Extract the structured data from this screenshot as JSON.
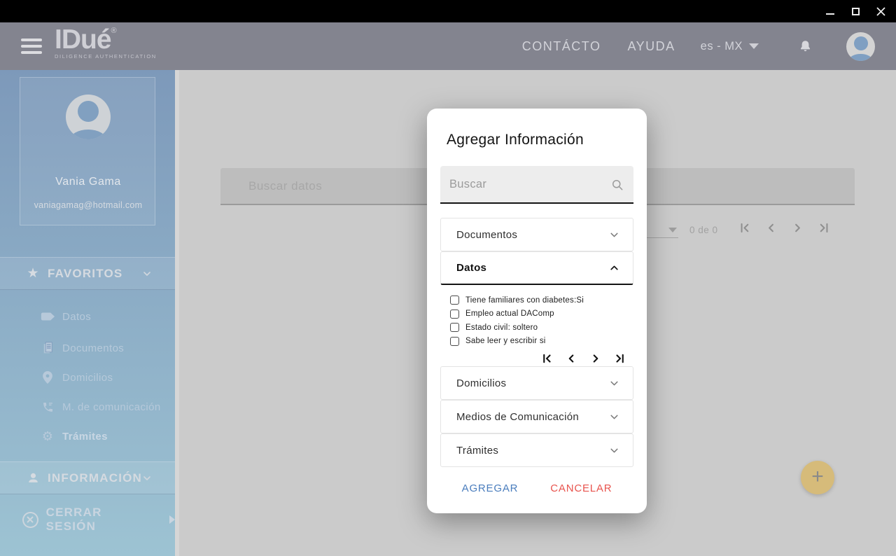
{
  "window": {
    "controls": {
      "minimize": "minimize",
      "maximize": "maximize",
      "close": "close"
    }
  },
  "header": {
    "logo": "IDué",
    "logo_mark": "®",
    "logo_sub": "DILIGENCE AUTHENTICATION",
    "nav": [
      {
        "label": "CONTÁCTO"
      },
      {
        "label": "AYUDA"
      }
    ],
    "language": "es - MX"
  },
  "sidebar": {
    "user": {
      "name": "Vania Gama",
      "email": "vaniagamag@hotmail.com"
    },
    "favorites": {
      "label": "FAVORITOS",
      "items": [
        {
          "label": "Datos",
          "icon": "tag-icon"
        },
        {
          "label": "Documentos",
          "icon": "documents-icon"
        },
        {
          "label": "Domicilios",
          "icon": "location-pin-icon"
        },
        {
          "label": "M. de comunicación",
          "icon": "phone-icon"
        },
        {
          "label": "Trámites",
          "icon": "gear-icon"
        }
      ]
    },
    "information": {
      "label": "INFORMACIÓN"
    },
    "logout": {
      "label": "CERRAR SESIÓN"
    }
  },
  "content": {
    "search_placeholder": "Buscar datos",
    "pagination": {
      "range_label": "0 de 0"
    }
  },
  "fab": {
    "icon": "plus",
    "color": "#d6bb7a"
  },
  "modal": {
    "title": "Agregar Información",
    "search_placeholder": "Buscar",
    "sections": [
      {
        "label": "Documentos",
        "expanded": false
      },
      {
        "label": "Datos",
        "expanded": true,
        "items": [
          {
            "label": "Tiene familiares con diabetes:Si",
            "checked": false
          },
          {
            "label": "Empleo actual DAComp",
            "checked": false
          },
          {
            "label": "Estado civil: soltero",
            "checked": false
          },
          {
            "label": "Sabe leer y escribir si",
            "checked": false
          }
        ]
      },
      {
        "label": "Domicilios",
        "expanded": false
      },
      {
        "label": "Medios de Comunicación",
        "expanded": false
      },
      {
        "label": "Trámites",
        "expanded": false
      }
    ],
    "actions": {
      "add": "AGREGAR",
      "cancel": "CANCELAR"
    }
  },
  "colors": {
    "accent_blue": "#4a7dbd",
    "accent_red": "#e8544e",
    "fab_yellow": "#d6bb7a",
    "header_gray": "#83848f",
    "sidebar_blue": "#7d99ba"
  }
}
